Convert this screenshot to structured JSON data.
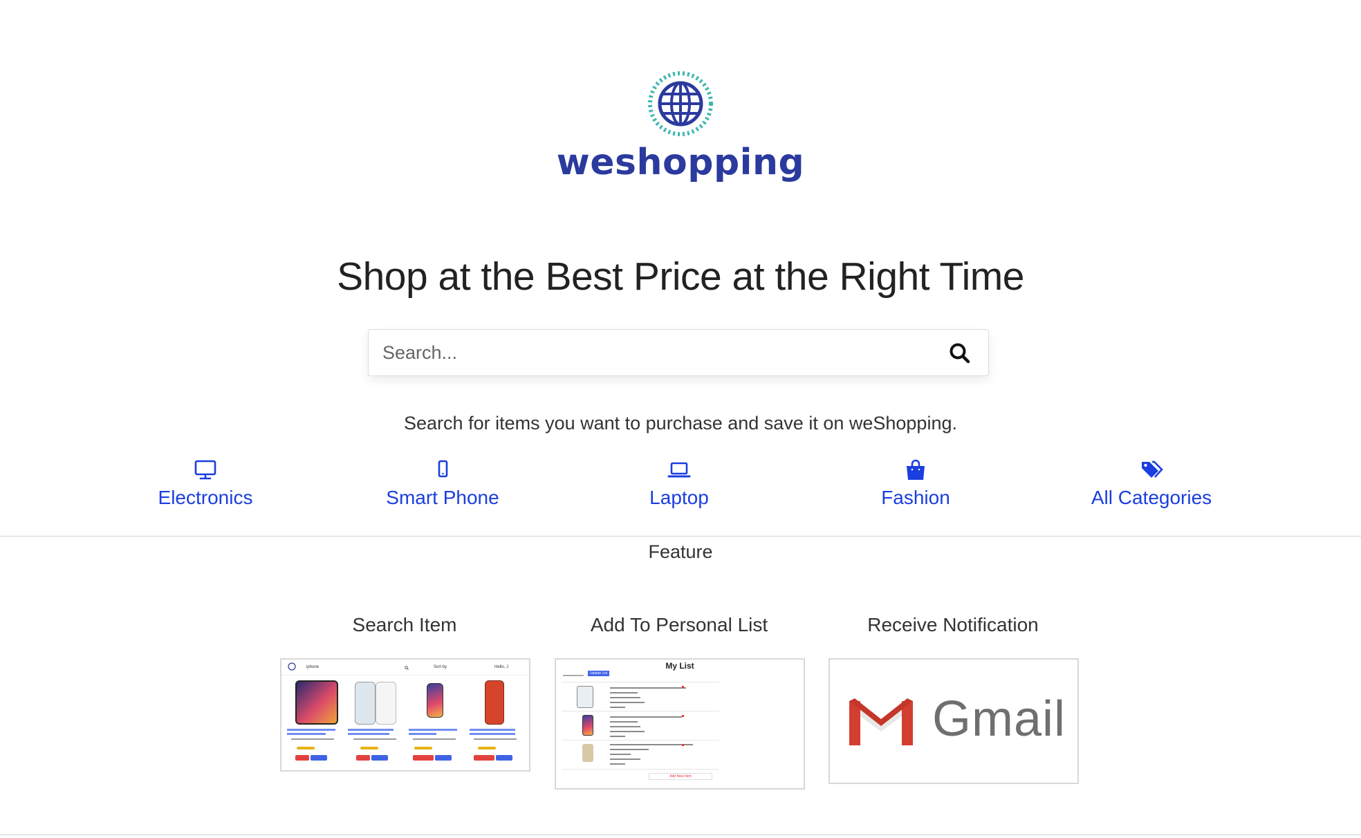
{
  "brand": {
    "name": "weshopping",
    "primary_color": "#2b3a9e",
    "ring_color": "#3bb7b0"
  },
  "hero": {
    "headline": "Shop at the Best Price at the Right Time",
    "search_placeholder": "Search...",
    "tagline": "Search for items you want to purchase and save it on weShopping."
  },
  "categories": [
    {
      "label": "Electronics",
      "icon": "desktop-monitor-icon"
    },
    {
      "label": "Smart Phone",
      "icon": "mobile-phone-icon"
    },
    {
      "label": "Laptop",
      "icon": "laptop-icon"
    },
    {
      "label": "Fashion",
      "icon": "shopping-bag-icon"
    },
    {
      "label": "All Categories",
      "icon": "tags-icon"
    }
  ],
  "link_color": "#1a3ee0",
  "feature": {
    "heading": "Feature",
    "cards": [
      {
        "title": "Search Item",
        "preview": {
          "search_query": "iphone",
          "sort_label": "Sort by",
          "user_label": "Hello, J"
        }
      },
      {
        "title": "Add To Personal List",
        "preview": {
          "list_title": "My List",
          "button_label": "Update List",
          "footer_label": "Add New Item"
        }
      },
      {
        "title": "Receive Notification",
        "preview": {
          "logo_word": "Gmail"
        }
      }
    ]
  }
}
